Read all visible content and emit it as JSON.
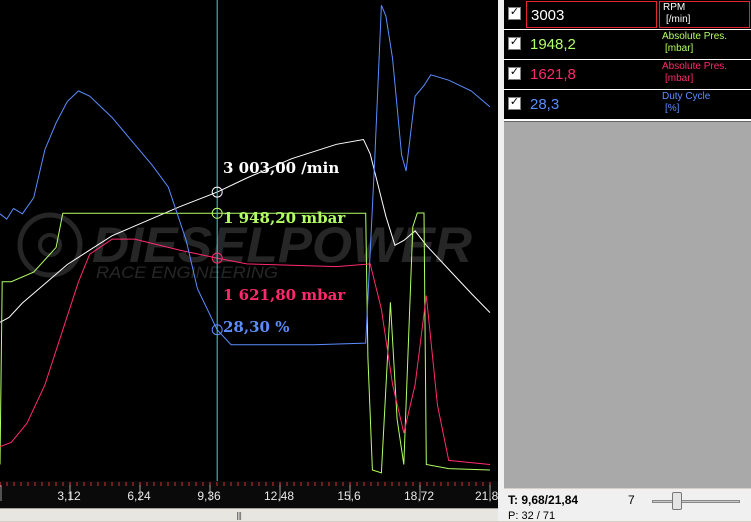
{
  "plot": {
    "watermark_brand": "DIESELPOWER",
    "watermark_sub": "RACE ENGINEERING",
    "cursor_readouts": [
      {
        "text": "3 003,00 /min",
        "color": "#ffffff"
      },
      {
        "text": "1 948,20 mbar",
        "color": "#b3ff66"
      },
      {
        "text": "1 621,80 mbar",
        "color": "#ff2a6d"
      },
      {
        "text": "28,30 %",
        "color": "#5b8dff"
      }
    ]
  },
  "axis": {
    "tick_labels": [
      "3,12",
      "6,24",
      "9,36",
      "12,48",
      "15,6",
      "18,72",
      "21,8"
    ]
  },
  "channels": [
    {
      "value": "3003",
      "label": "RPM",
      "unit": "[/min]",
      "color": "#ffffff",
      "label_color": "#ffffff",
      "checked": true,
      "highlight": true
    },
    {
      "value": "1948,2",
      "label": "Absolute Pres.",
      "unit": "[mbar]",
      "color": "#b3ff66",
      "label_color": "#b3ff66",
      "checked": true,
      "highlight": false
    },
    {
      "value": "1621,8",
      "label": "Absolute Pres.",
      "unit": "[mbar]",
      "color": "#ff2a6d",
      "label_color": "#ff2a6d",
      "checked": true,
      "highlight": false
    },
    {
      "value": "28,3",
      "label": "Duty Cycle",
      "unit": "[%]",
      "color": "#5b8dff",
      "label_color": "#5b8dff",
      "checked": true,
      "highlight": false
    }
  ],
  "status": {
    "time_readout": "T: 9,68/21,84",
    "point_readout": "P: 32 / 71",
    "zoom_value": "7",
    "zoom_position": 0.25
  },
  "chart_data": {
    "type": "line",
    "xlim": [
      0,
      21.84
    ],
    "cursor_x": 9.68,
    "x_ticks": [
      3.12,
      6.24,
      9.36,
      12.48,
      15.6,
      18.72,
      21.84
    ],
    "series": [
      {
        "name": "RPM",
        "unit": "/min",
        "color": "#ffffff",
        "ylim": [
          0,
          5000
        ],
        "points": [
          [
            0,
            1650
          ],
          [
            0.4,
            1700
          ],
          [
            1.0,
            1850
          ],
          [
            2.0,
            2050
          ],
          [
            3.0,
            2250
          ],
          [
            4.0,
            2400
          ],
          [
            5.0,
            2550
          ],
          [
            6.0,
            2650
          ],
          [
            7.0,
            2750
          ],
          [
            8.0,
            2850
          ],
          [
            9.68,
            3003
          ],
          [
            11,
            3150
          ],
          [
            13,
            3350
          ],
          [
            15,
            3500
          ],
          [
            16.2,
            3550
          ],
          [
            16.5,
            3400
          ],
          [
            17.2,
            2750
          ],
          [
            17.6,
            2450
          ],
          [
            18.0,
            2500
          ],
          [
            18.5,
            2600
          ],
          [
            19.0,
            2450
          ],
          [
            20,
            2200
          ],
          [
            21,
            1950
          ],
          [
            21.84,
            1750
          ]
        ]
      },
      {
        "name": "Absolute Pres.",
        "unit": "mbar",
        "color": "#b3ff66",
        "ylim": [
          0,
          3500
        ],
        "points": [
          [
            0,
            120
          ],
          [
            0.1,
            1450
          ],
          [
            0.5,
            1450
          ],
          [
            1.5,
            1520
          ],
          [
            2.5,
            1700
          ],
          [
            2.8,
            1948
          ],
          [
            9.68,
            1948.2
          ],
          [
            16.3,
            1948
          ],
          [
            16.4,
            900
          ],
          [
            16.6,
            80
          ],
          [
            17.0,
            60
          ],
          [
            17.4,
            1300
          ],
          [
            17.7,
            450
          ],
          [
            18.0,
            120
          ],
          [
            18.4,
            1850
          ],
          [
            18.6,
            1950
          ],
          [
            18.9,
            1950
          ],
          [
            19.0,
            120
          ],
          [
            20,
            90
          ],
          [
            21.84,
            80
          ]
        ]
      },
      {
        "name": "Absolute Pres.",
        "unit": "mbar",
        "color": "#ff2a6d",
        "ylim": [
          0,
          3500
        ],
        "points": [
          [
            0,
            250
          ],
          [
            0.5,
            280
          ],
          [
            1.2,
            420
          ],
          [
            2.0,
            700
          ],
          [
            2.8,
            1100
          ],
          [
            3.5,
            1450
          ],
          [
            4.0,
            1650
          ],
          [
            5.0,
            1760
          ],
          [
            6.0,
            1760
          ],
          [
            7.0,
            1720
          ],
          [
            8.0,
            1680
          ],
          [
            9.0,
            1645
          ],
          [
            9.68,
            1621.8
          ],
          [
            11,
            1580
          ],
          [
            13,
            1570
          ],
          [
            15,
            1560
          ],
          [
            16.5,
            1580
          ],
          [
            17.0,
            1250
          ],
          [
            17.5,
            700
          ],
          [
            18.0,
            350
          ],
          [
            18.5,
            700
          ],
          [
            19.0,
            1350
          ],
          [
            19.5,
            550
          ],
          [
            20,
            150
          ],
          [
            21.84,
            120
          ]
        ]
      },
      {
        "name": "Duty Cycle",
        "unit": "%",
        "color": "#5b8dff",
        "ylim": [
          0,
          90
        ],
        "points": [
          [
            0,
            50
          ],
          [
            0.3,
            49
          ],
          [
            0.6,
            51
          ],
          [
            1.0,
            50
          ],
          [
            1.5,
            53
          ],
          [
            2.0,
            62
          ],
          [
            2.5,
            67
          ],
          [
            3.0,
            71
          ],
          [
            3.5,
            73
          ],
          [
            4.0,
            72
          ],
          [
            5.0,
            68
          ],
          [
            6.0,
            63
          ],
          [
            6.8,
            59
          ],
          [
            7.5,
            55
          ],
          [
            8.3,
            45
          ],
          [
            8.8,
            36
          ],
          [
            9.68,
            28.3
          ],
          [
            10.3,
            25.5
          ],
          [
            12,
            25.5
          ],
          [
            14,
            25.5
          ],
          [
            16.3,
            25.8
          ],
          [
            16.7,
            60
          ],
          [
            17.0,
            89
          ],
          [
            17.2,
            87
          ],
          [
            17.5,
            79
          ],
          [
            17.9,
            61
          ],
          [
            18.1,
            58
          ],
          [
            18.5,
            72
          ],
          [
            18.9,
            74
          ],
          [
            19.2,
            76
          ],
          [
            20,
            75
          ],
          [
            21,
            73
          ],
          [
            21.84,
            70
          ]
        ]
      }
    ]
  }
}
